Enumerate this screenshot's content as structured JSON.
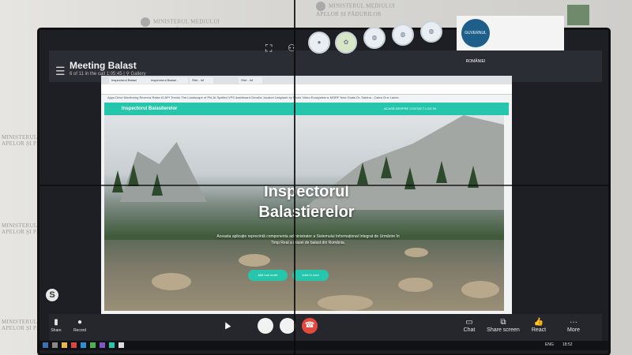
{
  "wall": {
    "sign_top_left": "MINISTERUL MEDIULUI\nAPELOR ȘI PĂDURILOR",
    "sign_top_right": "MINISTERUL MEDIULUI\nAPELOR ȘI PĂDURILOR",
    "sign_left_mid": "MINISTERUL MEDIULUI\nAPELOR ȘI PĂDURILOR",
    "sign_left_low": "MINISTERUL MEDIULUI\nAPELOR ȘI PĂDURILOR",
    "sign_left_bottom": "MINISTERUL MEDIULUI\nAPELOR ȘI PĂDURILOR"
  },
  "meeting": {
    "title": "Meeting Balast",
    "subtitle": "6 of 11 in the call 1:05:45 | ⚲ Gallery"
  },
  "logo": {
    "text": "GUVERNUL ROMÂNIEI"
  },
  "browser": {
    "tabs": [
      "Inspectorul Balast",
      "Inspectorul Balast - Paged",
      "Sfnt - Inf",
      "Sfnt - Inf"
    ],
    "bookmarks": "Apps  Drive  Monitoring Rezerva   Ratec AI API  Trends   The Landscape of Phi-AI   Spelled VPS dashboard   Gmail  ▸ Jucatori  Unsplash by Photo   Video Ecosystem  ▸ MORF   New Goals  Dr. Sabina - Calea Gr   ▸ Lanes",
    "brand": "Inspectorul Balastierelor",
    "nav_links": "ACASĂ   DESPRE   CONTACT   LOG IN"
  },
  "hero": {
    "title_line1": "Inspectorul",
    "title_line2": "Balastierelor",
    "description": "Aceasta aplicație reprezintă componenta administrator a Sistemului Informațional Integrat de Urmărire în Timp Real a masei de balast din România.",
    "button_left": "Află mai multe",
    "button_right": "Intră în cont"
  },
  "bottom": {
    "share": "Share",
    "record": "Record",
    "chat": "Chat",
    "share_screen": "Share screen",
    "react": "React",
    "more": "More"
  },
  "taskbar": {
    "lang": "ENG",
    "time": "18:52"
  },
  "colors": {
    "accent": "#26c6ad",
    "hangup": "#e5483c"
  }
}
